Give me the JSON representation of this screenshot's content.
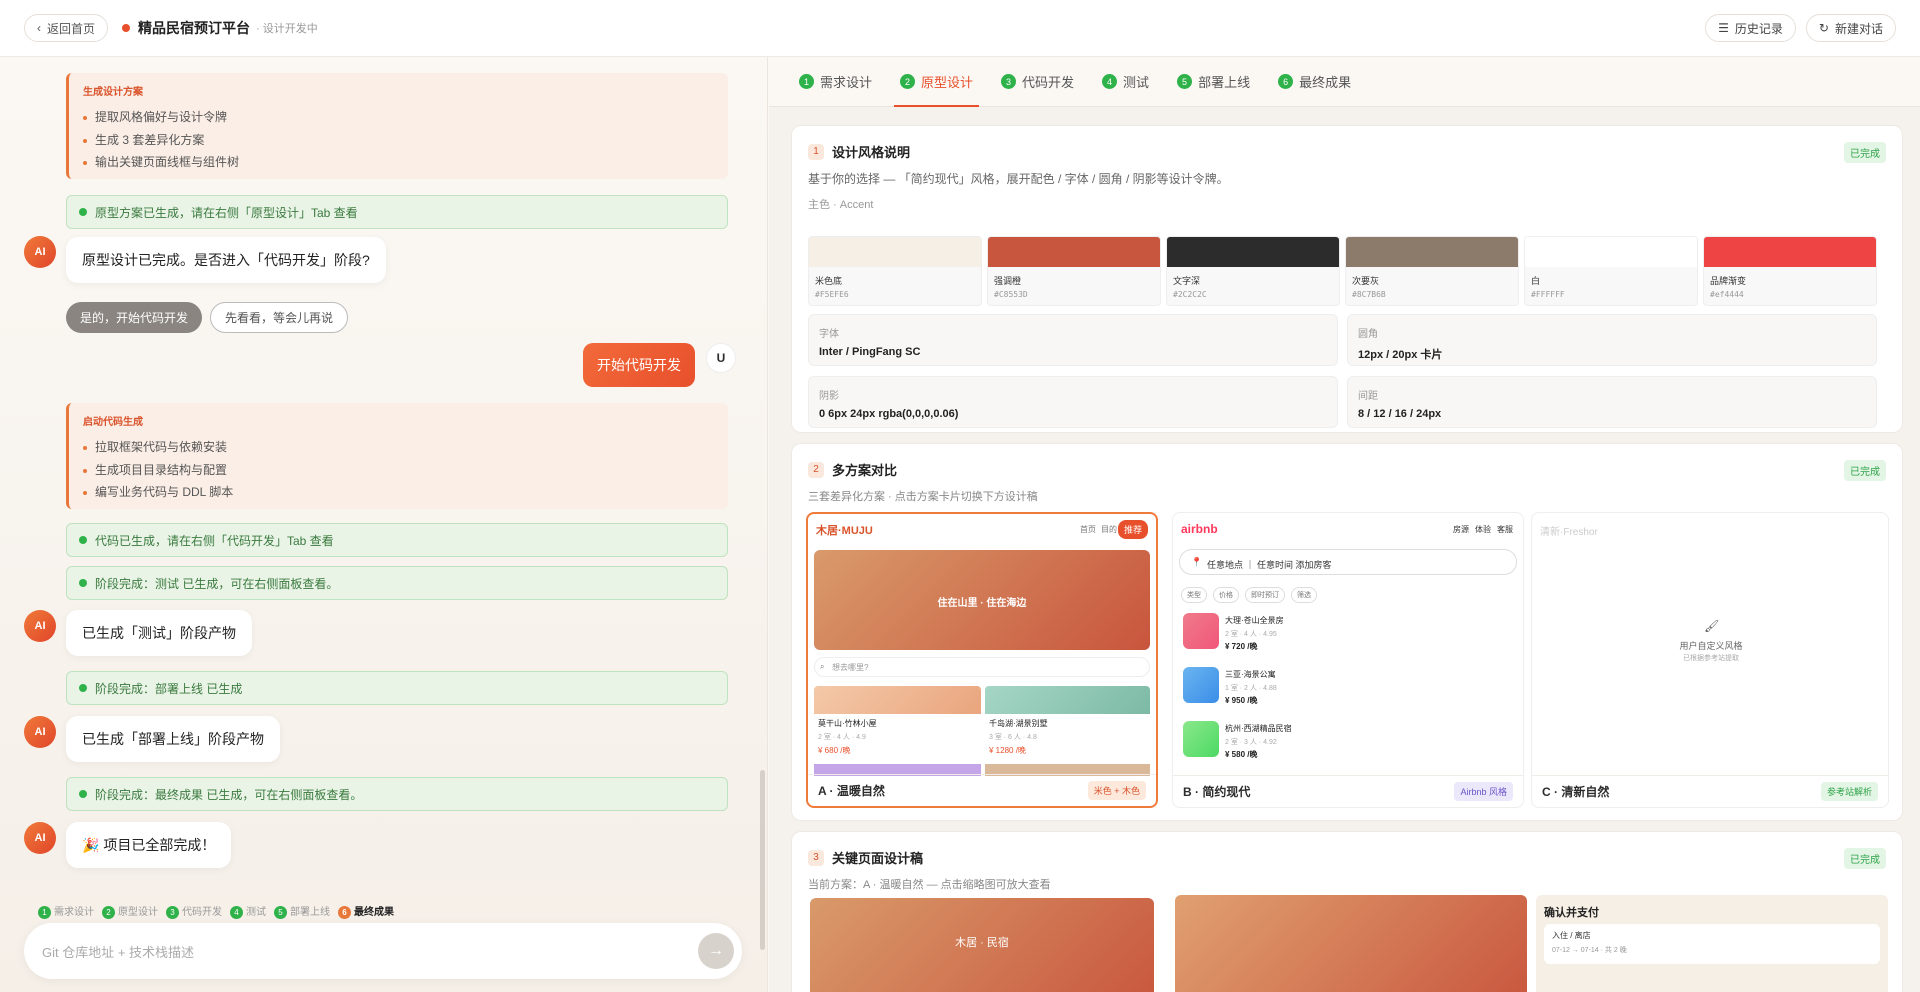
{
  "topbar": {
    "back": "返回首页",
    "title": "精品民宿预订平台",
    "subtitle": "· 设计开发中",
    "history": "历史记录",
    "new_chat": "新建对话"
  },
  "chat": {
    "card1": {
      "title": "生成设计方案",
      "items": [
        "提取风格偏好与设计令牌",
        "生成 3 套差异化方案",
        "输出关键页面线框与组件树"
      ]
    },
    "status1": "原型方案已生成，请在右侧「原型设计」Tab 查看",
    "ai1": "原型设计已完成。是否进入「代码开发」阶段?",
    "opt_yes": "是的，开始代码开发",
    "opt_wait": "先看看，等会儿再说",
    "user_msg": "开始代码开发",
    "user_avatar": "U",
    "ai_avatar": "AI",
    "card2": {
      "title": "启动代码生成",
      "items": [
        "拉取框架代码与依赖安装",
        "生成项目目录结构与配置",
        "编写业务代码与 DDL 脚本"
      ]
    },
    "status2": "代码已生成，请在右侧「代码开发」Tab 查看",
    "status3": "阶段完成：测试 已生成，可在右侧面板查看。",
    "ai2": "已生成「测试」阶段产物",
    "status4": "阶段完成：部署上线 已生成",
    "ai3": "已生成「部署上线」阶段产物",
    "status5": "阶段完成：最终成果 已生成，可在右侧面板查看。",
    "ai4": "🎉 项目已全部完成！"
  },
  "mini_steps": [
    {
      "n": "1",
      "l": "需求设计"
    },
    {
      "n": "2",
      "l": "原型设计"
    },
    {
      "n": "3",
      "l": "代码开发"
    },
    {
      "n": "4",
      "l": "测试"
    },
    {
      "n": "5",
      "l": "部署上线"
    },
    {
      "n": "6",
      "l": "最终成果"
    }
  ],
  "input": {
    "placeholder": "Git 仓库地址 + 技术栈描述",
    "send": "→"
  },
  "tabs": [
    {
      "n": "1",
      "l": "需求设计"
    },
    {
      "n": "2",
      "l": "原型设计"
    },
    {
      "n": "3",
      "l": "代码开发"
    },
    {
      "n": "4",
      "l": "测试"
    },
    {
      "n": "5",
      "l": "部署上线"
    },
    {
      "n": "6",
      "l": "最终成果"
    }
  ],
  "sec1": {
    "n": "1",
    "title": "设计风格说明",
    "badge": "已完成",
    "desc": "基于你的选择 — 「简约现代」风格，展开配色 / 字体 / 圆角 / 阴影等设计令牌。",
    "sub": "主色 · Accent",
    "swatches": [
      {
        "name": "米色底",
        "hex": "#F5EFE6",
        "color": "#F5EFE6"
      },
      {
        "name": "强调橙",
        "hex": "#C8553D",
        "color": "#C8553D"
      },
      {
        "name": "文字深",
        "hex": "#2C2C2C",
        "color": "#2C2C2C"
      },
      {
        "name": "次要灰",
        "hex": "#8C7B6B",
        "color": "#8C7B6B"
      },
      {
        "name": "白",
        "hex": "#FFFFFF",
        "color": "#FFFFFF"
      },
      {
        "name": "品牌渐变",
        "hex": "#ef4444",
        "color": "#ef4444"
      }
    ],
    "tokens": [
      {
        "label": "字体",
        "value": "Inter / PingFang SC"
      },
      {
        "label": "圆角",
        "value": "12px / 20px 卡片"
      },
      {
        "label": "阴影",
        "value": "0 6px 24px rgba(0,0,0,0.06)"
      },
      {
        "label": "间距",
        "value": "8 / 12 / 16 / 24px"
      }
    ]
  },
  "sec2": {
    "n": "2",
    "title": "多方案对比",
    "badge": "已完成",
    "desc": "三套差异化方案 · 点击方案卡片切换下方设计稿",
    "planA": {
      "brand": "木居·MUJU",
      "nav1": "首页",
      "nav2": "目的",
      "rec": "推荐",
      "hero": "住在山里 · 住在海边",
      "search": "想去哪里?",
      "c1": "莫干山·竹林小屋",
      "c1m": "2 室 · 4 人 · 4.9",
      "c1p": "¥ 680 /晚",
      "c2": "千岛湖·湖景别墅",
      "c2m": "3 室 · 6 人 · 4.8",
      "c2p": "¥ 1280 /晚",
      "name": "A · 温暖自然",
      "tag": "米色 + 木色"
    },
    "planB": {
      "brand": "airbnb",
      "nav1": "房源",
      "nav2": "体验",
      "nav3": "客服",
      "search": "任意地点 ｜ 任意时间   添加房客",
      "chips": [
        "类型",
        "价格",
        "即时预订",
        "筛选"
      ],
      "items": [
        {
          "t": "大理·苍山全景房",
          "m": "2 室 · 4 人 · 4.95",
          "p": "¥ 720 /晚",
          "c": "#f0577a"
        },
        {
          "t": "三亚·海景公寓",
          "m": "1 室 · 2 人 · 4.88",
          "p": "¥ 950 /晚",
          "c": "#3a8ee8"
        },
        {
          "t": "杭州·西湖精品民宿",
          "m": "2 室 · 3 人 · 4.92",
          "p": "¥ 580 /晚",
          "c": "#4cd964"
        }
      ],
      "name": "B · 简约现代",
      "tag": "Airbnb 风格"
    },
    "planC": {
      "brand": "清新·Freshor",
      "label": "用户自定义风格",
      "sub": "已根据参考站提取",
      "name": "C · 清新自然",
      "tag": "参考站解析"
    }
  },
  "sec3": {
    "n": "3",
    "title": "关键页面设计稿",
    "badge": "已完成",
    "desc": "当前方案：A · 温暖自然 — 点击缩略图可放大查看",
    "t1": "木居 · 民宿",
    "pay": "确认并支付",
    "pay_l": "入住 / 离店",
    "pay_v": "07-12 → 07-14 · 共 2 晚"
  }
}
